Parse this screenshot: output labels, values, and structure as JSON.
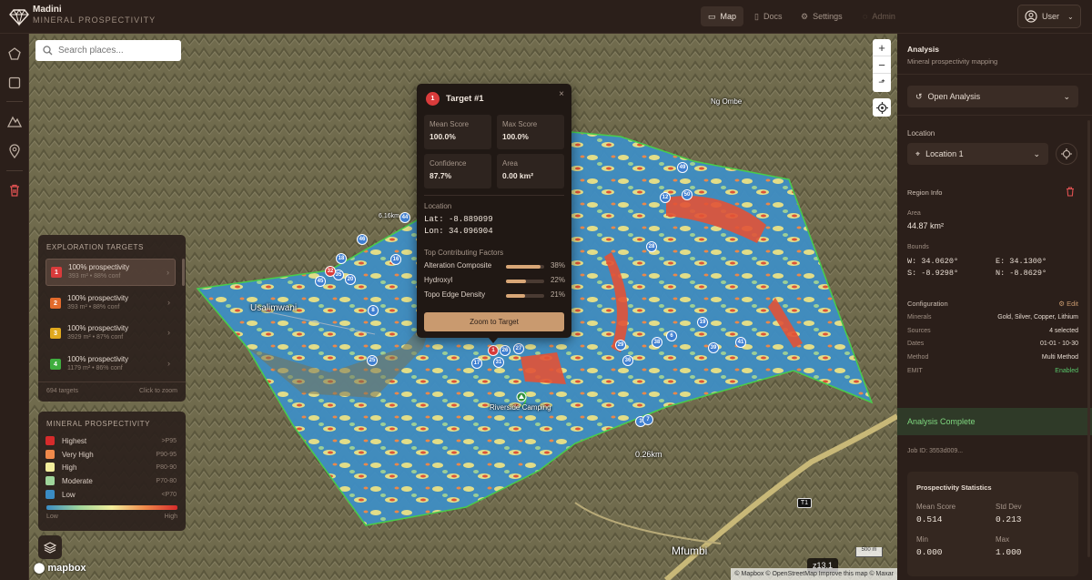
{
  "app": {
    "name": "Madini",
    "subtitle": "MINERAL PROSPECTIVITY"
  },
  "nav": [
    {
      "label": "Map",
      "icon": "map-icon",
      "active": true
    },
    {
      "label": "Docs",
      "icon": "document-icon",
      "active": false
    },
    {
      "label": "Settings",
      "icon": "gear-icon",
      "active": false
    },
    {
      "label": "Admin",
      "icon": "shield-icon",
      "active": false
    }
  ],
  "user": {
    "label": "User"
  },
  "search": {
    "placeholder": "Search places..."
  },
  "map_labels": {
    "usalimwani": "Usalimwani",
    "ngombe": "Ng Ombe",
    "camping": "Riverside Camping",
    "mfumbi": "Mfumbi",
    "road": "T1",
    "dist1": "0.26km",
    "dist2": "6.16km",
    "zoom": "z13.1",
    "scale": "500 m",
    "attribution": "© Mapbox © OpenStreetMap Improve this map © Maxar",
    "mapbox": "mapbox"
  },
  "targets_card": {
    "title": "EXPLORATION TARGETS",
    "items": [
      {
        "num": "1",
        "color": "#d93b3b",
        "title": "100% prospectivity",
        "area": "393 m²",
        "conf": "88% conf"
      },
      {
        "num": "2",
        "color": "#e26b2c",
        "title": "100% prospectivity",
        "area": "393 m²",
        "conf": "88% conf"
      },
      {
        "num": "3",
        "color": "#e0a81e",
        "title": "100% prospectivity",
        "area": "3929 m²",
        "conf": "87% conf"
      },
      {
        "num": "4",
        "color": "#3fae3f",
        "title": "100% prospectivity",
        "area": "1179 m²",
        "conf": "86% conf"
      }
    ],
    "count": "694 targets",
    "hint": "Click to zoom"
  },
  "legend_card": {
    "title": "MINERAL PROSPECTIVITY",
    "items": [
      {
        "label": "Highest",
        "range": ">P95",
        "color": "#d62b2b"
      },
      {
        "label": "Very High",
        "range": "P90-95",
        "color": "#f08a4b"
      },
      {
        "label": "High",
        "range": "P80-90",
        "color": "#f3ee9c"
      },
      {
        "label": "Moderate",
        "range": "P70-80",
        "color": "#9fd59b"
      },
      {
        "label": "Low",
        "range": "<P70",
        "color": "#3a8cc4"
      }
    ],
    "low": "Low",
    "high": "High"
  },
  "popup": {
    "num": "1",
    "title": "Target #1",
    "mean_label": "Mean Score",
    "mean": "100.0%",
    "max_label": "Max Score",
    "max": "100.0%",
    "conf_label": "Confidence",
    "conf": "87.7%",
    "area_label": "Area",
    "area": "0.00 km²",
    "location_label": "Location",
    "lat": "Lat: -8.889099",
    "lon": "Lon: 34.096904",
    "factors_label": "Top Contributing Factors",
    "factors": [
      {
        "name": "Alteration Composite",
        "pct": "38%",
        "frac": 0.38
      },
      {
        "name": "Hydroxyl",
        "pct": "22%",
        "frac": 0.22
      },
      {
        "name": "Topo Edge Density",
        "pct": "21%",
        "frac": 0.21
      }
    ],
    "zoom_btn": "Zoom to Target"
  },
  "markers": [
    "1",
    "26",
    "27",
    "31",
    "17",
    "25",
    "8",
    "20",
    "35",
    "45",
    "32",
    "18",
    "46",
    "16",
    "44",
    "28",
    "12",
    "50",
    "49",
    "29",
    "36",
    "38",
    "6",
    "19",
    "39",
    "41",
    "3",
    "7"
  ],
  "right": {
    "title": "Analysis",
    "subtitle": "Mineral prospectivity mapping",
    "open_analysis": "Open Analysis",
    "location_label": "Location",
    "location_value": "Location 1",
    "region_info": "Region Info",
    "area_label": "Area",
    "area_value": "44.87 km²",
    "bounds_label": "Bounds",
    "w": "W: 34.0620°",
    "e": "E: 34.1300°",
    "s": "S: -8.9298°",
    "n": "N: -8.8629°",
    "config_label": "Configuration",
    "edit": "Edit",
    "config": [
      {
        "k": "Minerals",
        "v": "Gold, Silver, Copper, Lithium"
      },
      {
        "k": "Sources",
        "v": "4 selected"
      },
      {
        "k": "Dates",
        "v": "01-01 - 10-30"
      },
      {
        "k": "Method",
        "v": "Multi Method"
      },
      {
        "k": "EMIT",
        "v": "Enabled"
      }
    ],
    "complete": "Analysis Complete",
    "job": "Job ID: 3553d009...",
    "stats_title": "Prospectivity Statistics",
    "mean_label": "Mean Score",
    "mean": "0.514",
    "std_label": "Std Dev",
    "std": "0.213",
    "min_label": "Min",
    "min": "0.000",
    "max_label": "Max",
    "max": "1.000"
  }
}
